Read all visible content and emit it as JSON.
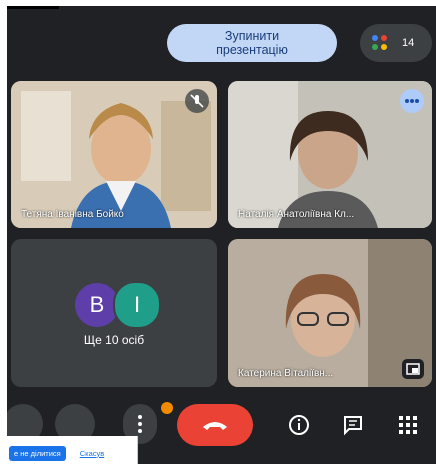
{
  "header": {
    "stop_presentation_label": "Зупинити\nпрезентацію",
    "participants_count": "14"
  },
  "tiles": [
    {
      "name": "Тетяна Іванівна Бойко"
    },
    {
      "name": "Наталія Анатоліївна Кл..."
    },
    {
      "avatars": [
        "B",
        "I"
      ],
      "others_label": "Ще 10 осіб"
    },
    {
      "name": "Катерина Віталіївн..."
    }
  ],
  "bottom_bar": {
    "share_popup_text": "е не ділитися",
    "share_popup_link": "Скасув"
  },
  "icons": {
    "mic_muted": "mic-off-icon",
    "more": "more-horiz-icon",
    "presenting": "present-icon",
    "people": "people-icon",
    "hangup": "call-end-icon",
    "info": "info-icon",
    "chat": "chat-icon",
    "apps": "apps-grid-icon",
    "menu": "more-vert-icon"
  }
}
